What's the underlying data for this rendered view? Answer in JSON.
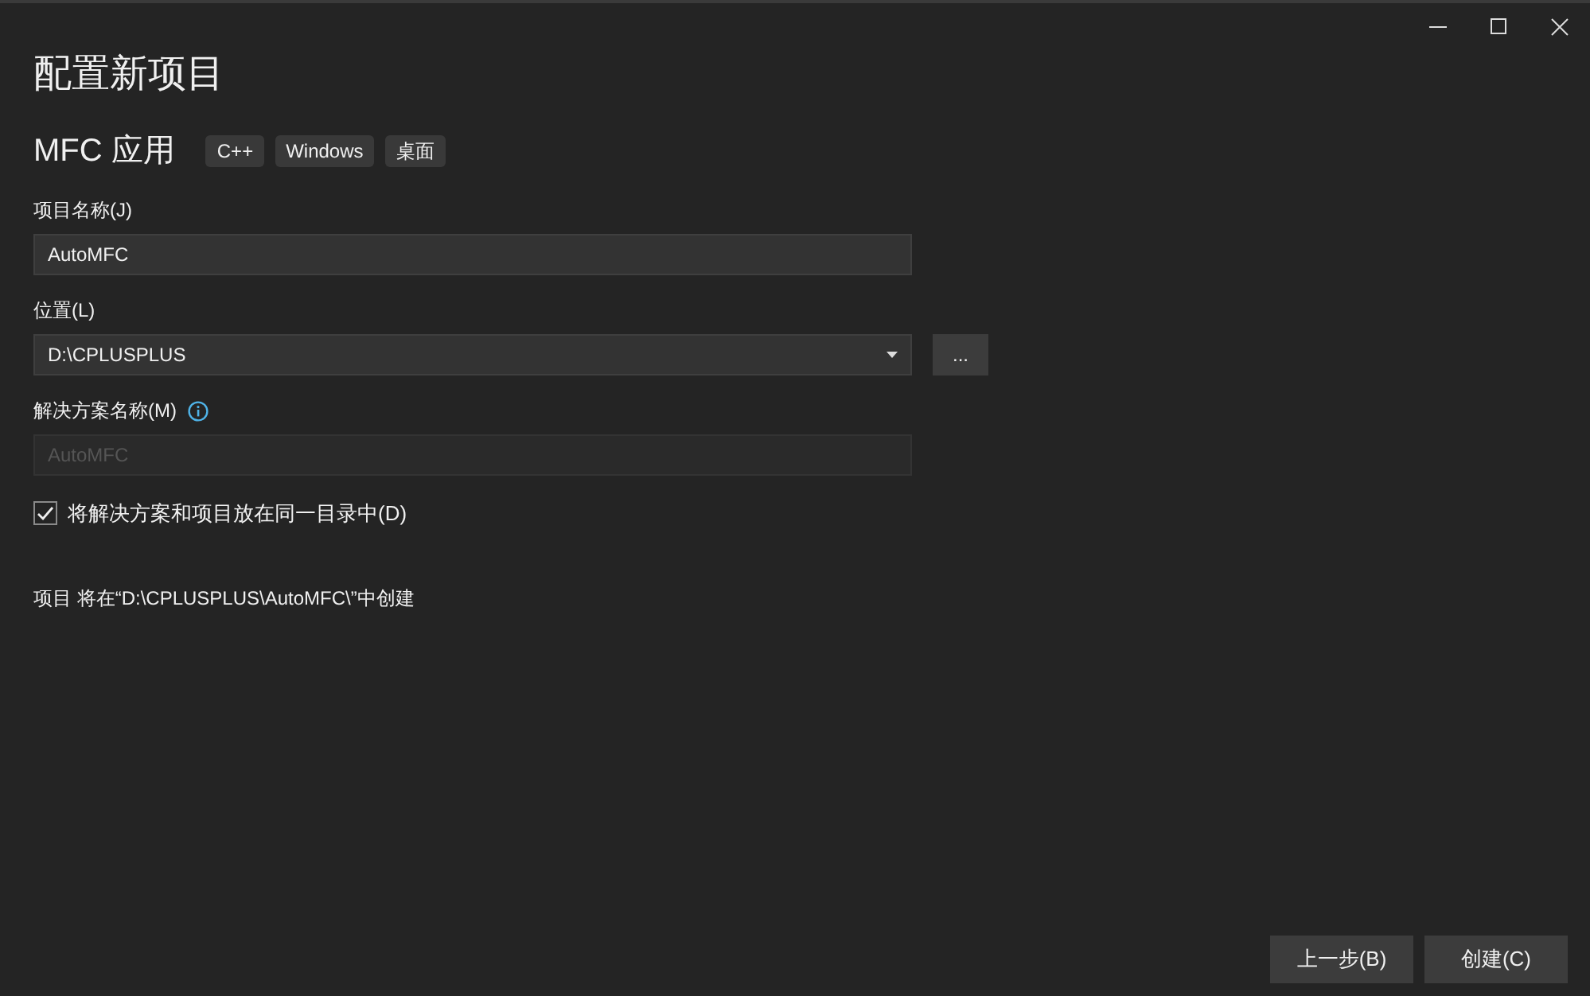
{
  "title": "配置新项目",
  "template": {
    "name": "MFC 应用",
    "tags": [
      "C++",
      "Windows",
      "桌面"
    ]
  },
  "fields": [
    {
      "kind": "text",
      "label": "项目名称(J)",
      "value": "AutoMFC",
      "disabled": false
    },
    {
      "kind": "dropdown",
      "label": "位置(L)",
      "value": "D:\\CPLUSPLUS",
      "browse_button": "..."
    },
    {
      "kind": "text",
      "label": "解决方案名称(M)",
      "value": "AutoMFC",
      "disabled": true,
      "info": true
    }
  ],
  "same_directory": {
    "label": "将解决方案和项目放在同一目录中(D)",
    "checked": true
  },
  "summary": "项目 将在“D:\\CPLUSPLUS\\AutoMFC\\”中创建",
  "buttons": [
    "上一步(B)",
    "创建(C)"
  ]
}
